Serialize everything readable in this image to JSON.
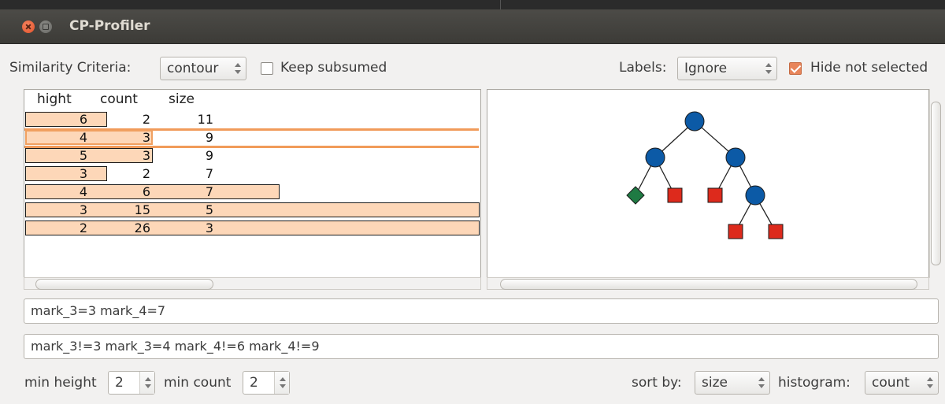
{
  "window": {
    "title": "CP-Profiler"
  },
  "toolbar": {
    "similarity_label": "Similarity Criteria:",
    "similarity_value": "contour",
    "keep_subsumed_label": "Keep subsumed",
    "keep_subsumed_checked": false,
    "labels_label": "Labels:",
    "labels_value": "Ignore",
    "hide_not_selected_label": "Hide not selected",
    "hide_not_selected_checked": true
  },
  "table": {
    "headers": [
      "hight",
      "count",
      "size"
    ],
    "rows": [
      {
        "hight": "6",
        "count": "2",
        "size": "11",
        "bar_fraction": 0.18
      },
      {
        "hight": "4",
        "count": "3",
        "size": "9",
        "bar_fraction": 0.28,
        "selected": true
      },
      {
        "hight": "5",
        "count": "3",
        "size": "9",
        "bar_fraction": 0.28
      },
      {
        "hight": "3",
        "count": "2",
        "size": "7",
        "bar_fraction": 0.18
      },
      {
        "hight": "4",
        "count": "6",
        "size": "7",
        "bar_fraction": 0.56
      },
      {
        "hight": "3",
        "count": "15",
        "size": "5",
        "bar_fraction": 1.0
      },
      {
        "hight": "2",
        "count": "26",
        "size": "3",
        "bar_fraction": 1.0
      }
    ]
  },
  "tree": {
    "node_colors": {
      "branch": "#0c5aa6",
      "failed": "#dd2a1c",
      "solution": "#1f7a43"
    }
  },
  "filters": {
    "equal_text": "mark_3=3 mark_4=7",
    "notequal_text": "mark_3!=3 mark_3=4 mark_4!=6 mark_4!=9"
  },
  "bottom": {
    "min_height_label": "min height",
    "min_height_value": "2",
    "min_count_label": "min count",
    "min_count_value": "2",
    "sort_by_label": "sort by:",
    "sort_by_value": "size",
    "histogram_label": "histogram:",
    "histogram_value": "count"
  },
  "colors": {
    "accent": "#f19b5a",
    "bar_fill": "#fdd7b8"
  }
}
